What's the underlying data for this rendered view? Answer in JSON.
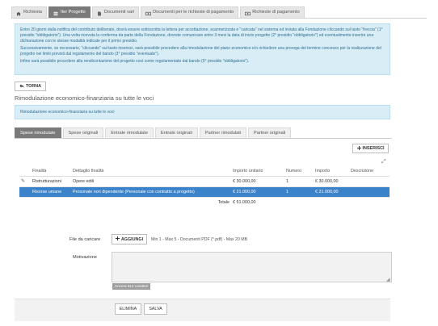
{
  "tabs": [
    {
      "label": "Richiesta",
      "icon": "home-icon",
      "active": false
    },
    {
      "label": "Iter Progetto",
      "icon": "list-icon",
      "active": true
    },
    {
      "label": "Documenti vari",
      "icon": "document-icon",
      "active": false
    },
    {
      "label": "Documenti per le richieste di pagamento",
      "icon": "money-icon",
      "active": false
    },
    {
      "label": "Richieste di pagamento",
      "icon": "money-icon",
      "active": false
    }
  ],
  "info": {
    "p1": "Entro 20 giorni dalla notifica del contributo deliberato, dovrà essere sottoscritta la lettera per accettazione, scannerizzata e \"caricata\" nel sistema ed inviata alla Fondazione cliccando sul tasto \"freccia\" (1° presidio \"obbligatorio\"). Una volta ricevuta la conferma da parte della Fondazione, dovrete comunicare entro 3 mesi la data di inizio progetto (2° presidio \"obbligatorio\") ed eventualmente inserire una dichiarazione con le stesse modalità indicate per il primo presidio.",
    "p2": "Successivamente, se necessario, \"cliccando\" sul tasto inserisci, sarà possibile procedere alla rimodulazione del piano economico e/o richiedere una proroga del termine concesso per la realizzazione del progetto nei limiti previsti dal regolamento del bando (3° presidio \"eventuale\").",
    "p3": "Infine sarà possibile procedere alla rendicontazione del progetto così come regolamentato dal bando (5° presidio \"obbligatorio\")."
  },
  "back_label": "TORNA",
  "section_title": "Rimodulazione economico-finanziaria su tutte le voci",
  "section_info": "Rimodulazione economico-finanziaria su tutte le voci",
  "subtabs": [
    {
      "label": "Spese rimodulate",
      "active": true
    },
    {
      "label": "Spese originali",
      "active": false
    },
    {
      "label": "Entrate rimodulate",
      "active": false
    },
    {
      "label": "Entrate originali",
      "active": false
    },
    {
      "label": "Partner rimodulati",
      "active": false
    },
    {
      "label": "Partner originali",
      "active": false
    }
  ],
  "insert_label": "INSERISCI",
  "table": {
    "headers": [
      "Finalità",
      "Dettaglio finalità",
      "Importo unitario",
      "Numero",
      "Importo",
      "Descrizione"
    ],
    "rows": [
      {
        "finalita": "Ristrutturazioni",
        "dettaglio": "Opere edili",
        "importo_unitario": "€ 30.000,00",
        "numero": "1",
        "importo": "€ 30.000,00",
        "descrizione": "",
        "selected": false
      },
      {
        "finalita": "Risorse umane",
        "dettaglio": "Personale non dipendente (Personale con contratto a progetto)",
        "importo_unitario": "€ 21.000,00",
        "numero": "1",
        "importo": "€ 21.000,00",
        "descrizione": "",
        "selected": true
      }
    ],
    "total_label": "Totale",
    "total_value": "€ 51.000,00"
  },
  "upload": {
    "label": "File da caricare",
    "button": "AGGIUNGI",
    "hint": "Min 1 - Max 5 - Documenti PDF (*.pdf) - Max 20 MB"
  },
  "motivation": {
    "label": "Motivazione",
    "value": "",
    "counter": "Ancora 512 caratteri"
  },
  "footer": {
    "delete_label": "ELIMINA",
    "save_label": "SALVA"
  },
  "colors": {
    "tab_active": "#7a7a7a",
    "info_bg": "#d9edf7",
    "info_text": "#31708f",
    "row_selected": "#3a82c9"
  }
}
